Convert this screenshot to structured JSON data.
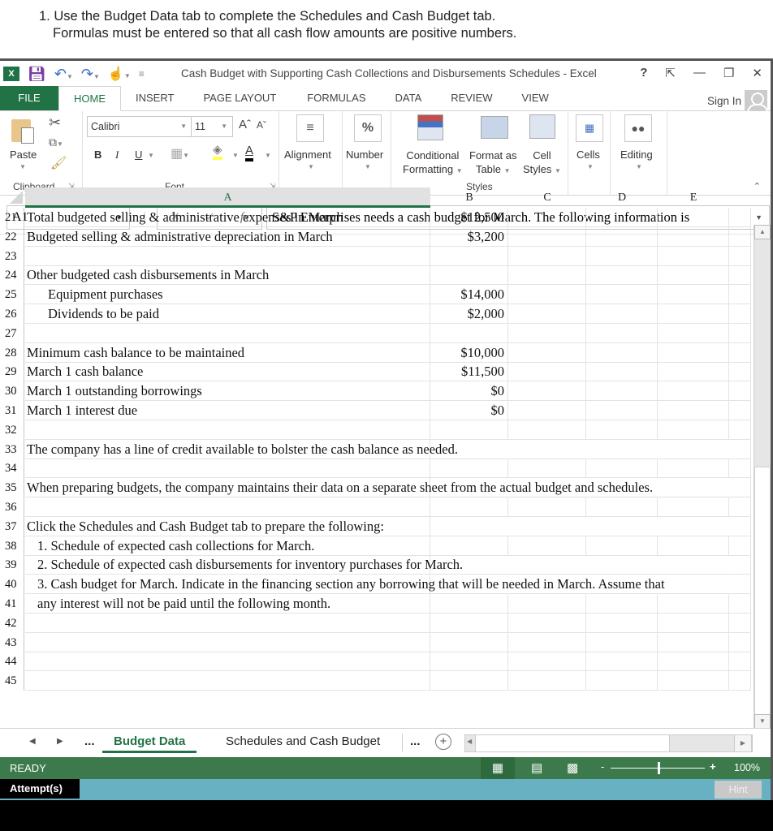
{
  "instructions": {
    "line1": "1. Use the Budget Data tab to complete the Schedules and Cash Budget tab.",
    "line2": "Formulas must be entered so that all cash flow amounts are positive numbers."
  },
  "window": {
    "title": "Cash Budget with Supporting Cash Collections and Disbursements Schedules - Excel",
    "help": "?",
    "app_icon": "excel-logo",
    "xl_label": "X"
  },
  "ribbon_tabs": [
    "FILE",
    "HOME",
    "INSERT",
    "PAGE LAYOUT",
    "FORMULAS",
    "DATA",
    "REVIEW",
    "VIEW"
  ],
  "sign_in": "Sign In",
  "ribbon": {
    "clipboard": {
      "paste": "Paste",
      "label": "Clipboard"
    },
    "font": {
      "name": "Calibri",
      "size": "11",
      "bold": "B",
      "italic": "I",
      "underline": "U",
      "label": "Font"
    },
    "alignment": "Alignment",
    "number": "Number",
    "number_icon": "%",
    "styles": {
      "conditional_1": "Conditional",
      "conditional_2": "Formatting",
      "format_table_1": "Format as",
      "format_table_2": "Table",
      "cell_styles_1": "Cell",
      "cell_styles_2": "Styles",
      "label": "Styles"
    },
    "cells": "Cells",
    "editing": "Editing"
  },
  "formula_bar": {
    "name_box": "A1",
    "content": "S&P Enterprises needs a cash budget for March. The following information is"
  },
  "columns": [
    "A",
    "B",
    "C",
    "D",
    "E"
  ],
  "rows": [
    {
      "num": "21",
      "a": "Total budgeted selling & administrative expenses in March",
      "b": "$12,500",
      "indent": false
    },
    {
      "num": "22",
      "a": "Budgeted selling & administrative depreciation in March",
      "b": "$3,200",
      "indent": false
    },
    {
      "num": "23",
      "a": "",
      "b": "",
      "indent": false
    },
    {
      "num": "24",
      "a": "Other budgeted cash disbursements in March",
      "b": "",
      "indent": false
    },
    {
      "num": "25",
      "a": "Equipment purchases",
      "b": "$14,000",
      "indent": true
    },
    {
      "num": "26",
      "a": "Dividends to be paid",
      "b": "$2,000",
      "indent": true
    },
    {
      "num": "27",
      "a": "",
      "b": "",
      "indent": false
    },
    {
      "num": "28",
      "a": "Minimum cash balance to be maintained",
      "b": "$10,000",
      "indent": false
    },
    {
      "num": "29",
      "a": "March 1 cash balance",
      "b": "$11,500",
      "indent": false
    },
    {
      "num": "30",
      "a": "March 1 outstanding borrowings",
      "b": "$0",
      "indent": false
    },
    {
      "num": "31",
      "a": "March 1 interest due",
      "b": "$0",
      "indent": false
    },
    {
      "num": "32",
      "a": "",
      "b": "",
      "indent": false
    },
    {
      "num": "33",
      "a": "The company has a line of credit available to bolster the cash balance as needed.",
      "b": "",
      "indent": false
    },
    {
      "num": "34",
      "a": "",
      "b": "",
      "indent": false
    },
    {
      "num": "35",
      "a": "When preparing budgets, the company maintains their data on a separate sheet from the actual budget and schedules.",
      "b": "",
      "indent": false
    },
    {
      "num": "36",
      "a": "",
      "b": "",
      "indent": false
    },
    {
      "num": "37",
      "a": "Click the Schedules and Cash Budget tab to prepare the following:",
      "b": "",
      "indent": false
    },
    {
      "num": "38",
      "a": "1. Schedule of expected cash collections for March.",
      "b": "",
      "indent": "small"
    },
    {
      "num": "39",
      "a": "2. Schedule of expected cash disbursements for inventory purchases for March.",
      "b": "",
      "indent": "small"
    },
    {
      "num": "40",
      "a": "3. Cash budget for March. Indicate in the financing section any borrowing that will be needed in March.  Assume that",
      "b": "",
      "indent": "small"
    },
    {
      "num": "41",
      "a": "any interest will not be paid until the following month.",
      "b": "",
      "indent": "small"
    },
    {
      "num": "42",
      "a": "",
      "b": "",
      "indent": false
    },
    {
      "num": "43",
      "a": "",
      "b": "",
      "indent": false
    },
    {
      "num": "44",
      "a": "",
      "b": "",
      "indent": false
    },
    {
      "num": "45",
      "a": "",
      "b": "",
      "indent": false
    }
  ],
  "sheet_tabs": {
    "ellipsis": "...",
    "tabs": [
      "Budget Data",
      "Schedules and Cash Budget"
    ],
    "active": "Budget Data"
  },
  "status_bar": {
    "state": "READY",
    "zoom": "100%",
    "zoom_minus": "-",
    "zoom_plus": "+"
  },
  "footer": {
    "attempts": "Attempt(s)",
    "hint": "Hint"
  },
  "colors": {
    "excel_green": "#217346",
    "status_green": "#3c7a4c",
    "attempt_bar": "#68b1c3"
  }
}
